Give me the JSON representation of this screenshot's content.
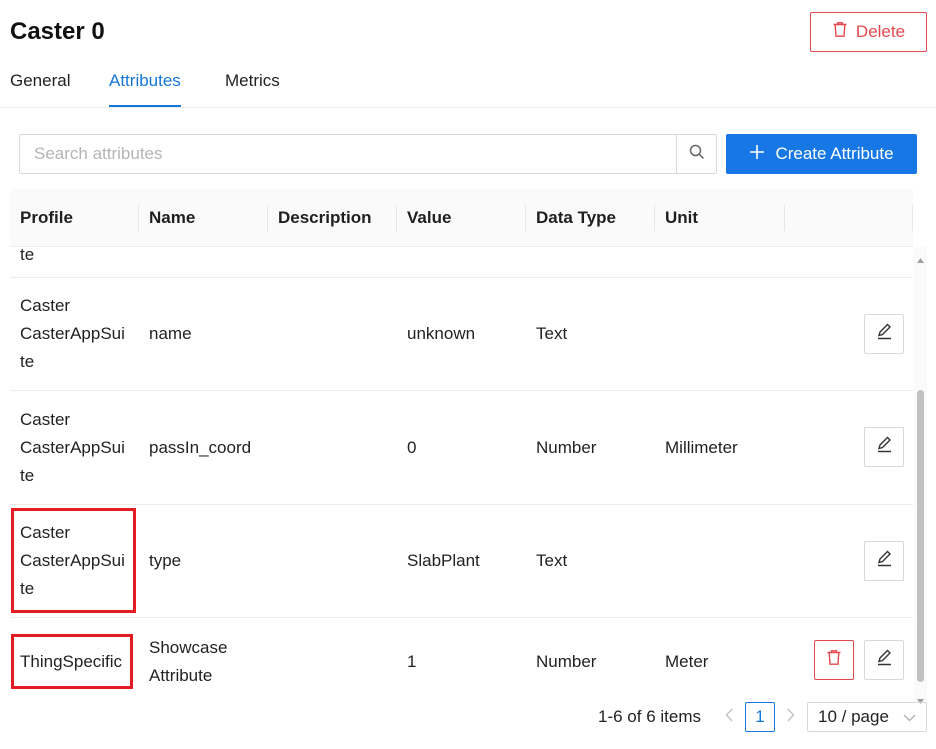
{
  "header": {
    "title": "Caster 0",
    "delete_label": "Delete"
  },
  "tabs": [
    {
      "label": "General",
      "active": false
    },
    {
      "label": "Attributes",
      "active": true
    },
    {
      "label": "Metrics",
      "active": false
    }
  ],
  "search": {
    "placeholder": "Search attributes",
    "value": ""
  },
  "create_button": {
    "label": "Create Attribute"
  },
  "table": {
    "columns": [
      "Profile",
      "Name",
      "Description",
      "Value",
      "Data Type",
      "Unit"
    ],
    "partial_row_text": "te",
    "rows": [
      {
        "profile": "Caster\nCasterAppSui\nte",
        "name": "name",
        "description": "",
        "value": "unknown",
        "data_type": "Text",
        "unit": "",
        "deletable": false
      },
      {
        "profile": "Caster\nCasterAppSui\nte",
        "name": "passIn_coord",
        "description": "",
        "value": "0",
        "data_type": "Number",
        "unit": "Millimeter",
        "deletable": false
      },
      {
        "profile": "Caster\nCasterAppSui\nte",
        "name": "type",
        "description": "",
        "value": "SlabPlant",
        "data_type": "Text",
        "unit": "",
        "deletable": false
      },
      {
        "profile": "ThingSpecific",
        "name": "Showcase\nAttribute",
        "description": "",
        "value": "1",
        "data_type": "Number",
        "unit": "Meter",
        "deletable": true
      }
    ]
  },
  "pagination": {
    "total_text": "1-6 of 6 items",
    "current_page": "1",
    "page_size": "10 / page"
  },
  "colors": {
    "accent": "#1677e5",
    "danger": "#e5484d",
    "highlight": "#e41c24"
  },
  "icons": [
    "trash-icon",
    "search-icon",
    "plus-icon",
    "edit-icon",
    "chevron-left-icon",
    "chevron-right-icon",
    "chevron-down-icon"
  ]
}
